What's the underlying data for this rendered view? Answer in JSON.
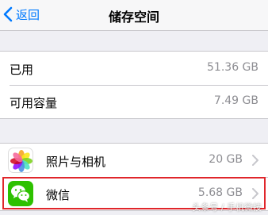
{
  "navbar": {
    "back_label": "返回",
    "title": "储存空间",
    "back_icon": "chevron-left-icon"
  },
  "storage": {
    "used": {
      "label": "已用",
      "value": "51.36 GB"
    },
    "available": {
      "label": "可用容量",
      "value": "7.49 GB"
    }
  },
  "apps": [
    {
      "name": "照片与相机",
      "size": "20 GB",
      "icon": "photos-icon"
    },
    {
      "name": "微信",
      "size": "5.68 GB",
      "icon": "wechat-icon"
    }
  ],
  "watermark": "头条号 / 手机微技",
  "colors": {
    "accent": "#007aff",
    "highlight": "#e0262b",
    "wechat_green": "#2dc100"
  }
}
